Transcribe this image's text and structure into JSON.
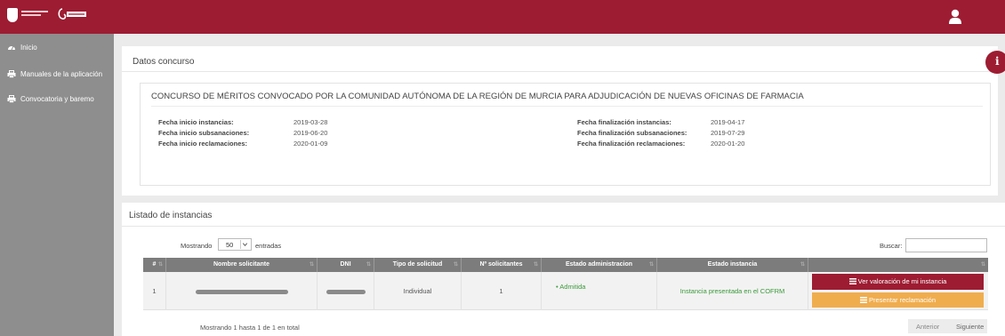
{
  "header": {
    "logo_text": "Región de Murcia",
    "user_icon": "user-icon"
  },
  "sidebar": {
    "items": [
      {
        "label": "Inicio",
        "icon": "dashboard-icon"
      },
      {
        "label": "Manuales de la aplicación",
        "icon": "print-icon"
      },
      {
        "label": "Convocatoria y baremo",
        "icon": "print-icon"
      }
    ]
  },
  "datos": {
    "title": "Datos concurso",
    "concurso": "CONCURSO DE MÉRITOS CONVOCADO POR LA COMUNIDAD AUTÓNOMA DE LA REGIÓN DE MURCIA PARA ADJUDICACIÓN DE NUEVAS OFICINAS DE FARMACIA",
    "left": [
      {
        "label": "Fecha inicio instancias:",
        "value": "2019-03-28"
      },
      {
        "label": "Fecha inicio subsanaciones:",
        "value": "2019-06-20"
      },
      {
        "label": "Fecha inicio reclamaciones:",
        "value": "2020-01-09"
      }
    ],
    "right": [
      {
        "label": "Fecha finalización instancias:",
        "value": "2019-04-17"
      },
      {
        "label": "Fecha finalización subsanaciones:",
        "value": "2019-07-29"
      },
      {
        "label": "Fecha finalización reclamaciones:",
        "value": "2020-01-20"
      }
    ],
    "info_button": "i"
  },
  "listado": {
    "title": "Listado de instancias",
    "length_prefix": "Mostrando",
    "length_value": "50",
    "length_suffix": "entradas",
    "search_label": "Buscar:",
    "search_value": "",
    "columns": [
      "#",
      "Nombre solicitante",
      "DNI",
      "Tipo de solicitud",
      "Nº solicitantes",
      "Estado administracion",
      "Estado instancia",
      ""
    ],
    "rows": [
      {
        "num": "1",
        "tipo": "Individual",
        "solicitantes": "1",
        "estado_admin": "• Admitida",
        "estado_instancia": "Instancia presentada en el COFRM",
        "btn_ver": "Ver valoración de mi instancia",
        "btn_reclamacion": "Presentar reclamación"
      }
    ],
    "footer_info": "Mostrando 1 hasta 1 de 1 en total",
    "prev": "Anterior",
    "next": "Siguiente"
  },
  "colors": {
    "brand": "#9d1c32",
    "sidebar": "#8e8e8e",
    "warning": "#f0ad4e",
    "success": "#3a9a3a"
  }
}
